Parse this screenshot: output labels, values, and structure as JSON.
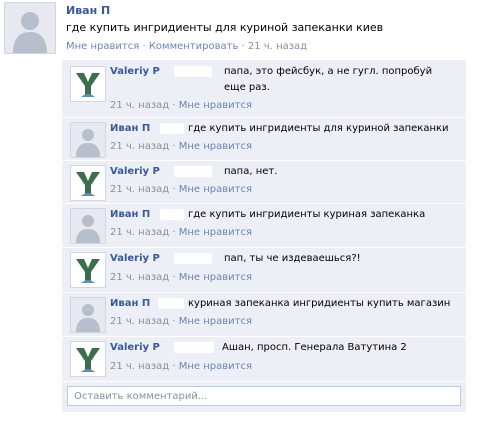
{
  "post": {
    "author": "Иван П",
    "text": "где купить ингридиенты для куриной запеканки киев",
    "like": "Мне нравится",
    "comment": "Комментировать",
    "time": "21 ч. назад"
  },
  "comments": [
    {
      "author": "Valeriy P",
      "text": "папа, это фейсбук, а не гугл. попробуй еще раз.",
      "time": "21 ч. назад",
      "like": "Мне нравится",
      "avatar": "tree-logo"
    },
    {
      "author": "Иван П",
      "text": "где купить ингридиенты для куриной запеканки",
      "time": "21 ч. назад",
      "like": "Мне нравится",
      "avatar": "default-person"
    },
    {
      "author": "Valeriy P",
      "text": "папа, нет.",
      "time": "21 ч. назад",
      "like": "Мне нравится",
      "avatar": "tree-logo"
    },
    {
      "author": "Иван П",
      "text": "где купить ингридиенты куриная запеканка",
      "time": "21 ч. назад",
      "like": "Мне нравится",
      "avatar": "default-person"
    },
    {
      "author": "Valeriy P",
      "text": "пап, ты че издеваешься?!",
      "time": "21 ч. назад",
      "like": "Мне нравится",
      "avatar": "tree-logo"
    },
    {
      "author": "Иван П",
      "text": "куриная запеканка ингридиенты купить магазин",
      "time": "21 ч. назад",
      "like": "Мне нравится",
      "avatar": "default-person"
    },
    {
      "author": "Valeriy P",
      "text": "Ашан, просп. Генерала Ватутина 2",
      "time": "21 ч. назад",
      "like": "Мне нравится",
      "avatar": "tree-logo"
    }
  ],
  "add_comment": {
    "placeholder": "Оставить комментарий..."
  },
  "separator": "·"
}
